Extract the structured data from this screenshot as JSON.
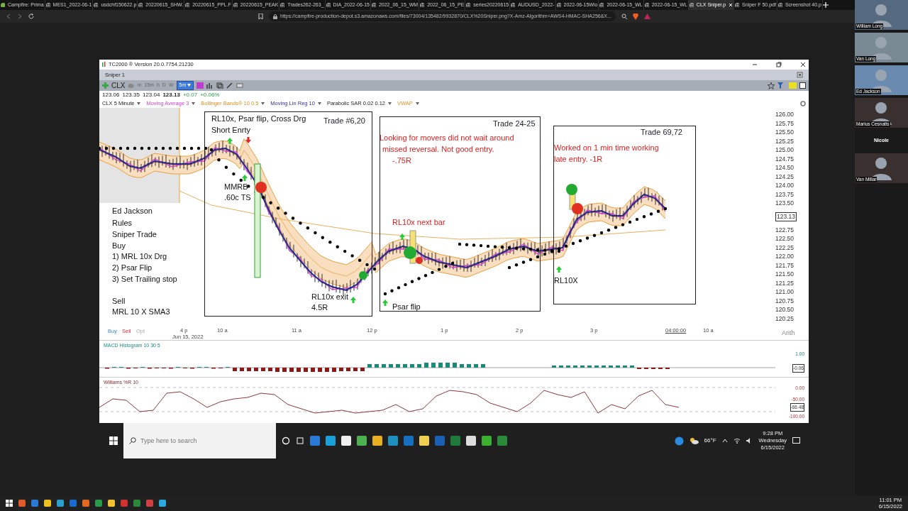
{
  "browser": {
    "tabs": [
      {
        "label": "Campfire: Prima",
        "selected": false
      },
      {
        "label": "MES1_2022-06-1",
        "selected": false
      },
      {
        "label": "usdchf150622.p",
        "selected": false
      },
      {
        "label": "20220615_SHW.",
        "selected": false
      },
      {
        "label": "20220615_PPL.F",
        "selected": false
      },
      {
        "label": "20220615_PEAK",
        "selected": false
      },
      {
        "label": "Trades262-263_",
        "selected": false
      },
      {
        "label": "DIA_2022-06-15",
        "selected": false
      },
      {
        "label": "2022_06_15_WM",
        "selected": false
      },
      {
        "label": "2022_06_15_PE",
        "selected": false
      },
      {
        "label": "series20220615",
        "selected": false
      },
      {
        "label": "AUDUSD_2022-",
        "selected": false
      },
      {
        "label": "2022-06-15Wio",
        "selected": false
      },
      {
        "label": "2022-06-15_WL",
        "selected": false
      },
      {
        "label": "2022-06-15_WL",
        "selected": false
      },
      {
        "label": "CLX Sniper.p",
        "selected": true
      },
      {
        "label": "Sniper F 50.pdf",
        "selected": false
      },
      {
        "label": "Screenshot 40.p",
        "selected": false
      }
    ],
    "url": "https://campfire-production-depot.s3.amazonaws.com/files/73004/135482/9932870/CLX%20Sniper.png?X-Amz-Algorithm=AWS4-HMAC-SHA256&X..."
  },
  "app": {
    "title": "TC2000 ® Version 20.0.7754.21230",
    "layout": "Sniper 1",
    "symbol": "CLX",
    "timeframes": [
      {
        "label": "m",
        "selected": false
      },
      {
        "label": "15m",
        "selected": false
      },
      {
        "label": "h",
        "selected": false
      },
      {
        "label": "D",
        "selected": false
      },
      {
        "label": "W",
        "selected": false
      },
      {
        "label": "5m",
        "selected": true
      }
    ],
    "quotes": [
      "123.06",
      "123.35",
      "123.04",
      "123.13",
      "+0.07",
      "+0.06%"
    ],
    "indicators": [
      {
        "label": "CLX 5 Minute",
        "kind": "price"
      },
      {
        "label": "Moving Average 3",
        "kind": "average"
      },
      {
        "label": "Bollinger Bands® 10 0.5",
        "kind": "band"
      },
      {
        "label": "Moving Lin Reg 10",
        "kind": "regression"
      },
      {
        "label": "Parabolic SAR 0.02 0.12",
        "kind": "sar"
      },
      {
        "label": "VWAP",
        "kind": "vwap"
      }
    ],
    "boxes": [
      {
        "title": "Trade #6,20"
      },
      {
        "title": "Trade 24-25"
      },
      {
        "title": "Trade 69,72"
      }
    ],
    "notes": [
      {
        "text": "RL10x, Psar flip, Cross Drg",
        "kind": "label"
      },
      {
        "text": "Short Enrty",
        "kind": "label"
      },
      {
        "text": "MMRB",
        "kind": "label"
      },
      {
        "text": ".60c TS",
        "kind": "label"
      },
      {
        "text": "RL10x exit",
        "kind": "label"
      },
      {
        "text": "4.5R",
        "kind": "label"
      },
      {
        "text": "Ed Jackson",
        "kind": "label"
      },
      {
        "text": "Rules",
        "kind": "label"
      },
      {
        "text": "Sniper Trade",
        "kind": "label"
      },
      {
        "text": "Buy",
        "kind": "label"
      },
      {
        "text": "1) MRL 10x Drg",
        "kind": "label"
      },
      {
        "text": "2) Psar Flip",
        "kind": "label"
      },
      {
        "text": "3) Set Trailing stop",
        "kind": "label"
      },
      {
        "text": "Sell",
        "kind": "label"
      },
      {
        "text": "MRL 10 X SMA3",
        "kind": "label"
      },
      {
        "text": "Looking for movers did not wait around",
        "kind": "remark"
      },
      {
        "text": "missed reversal. Not good entry.",
        "kind": "remark"
      },
      {
        "text": "-.75R",
        "kind": "remark"
      },
      {
        "text": "RL10x next bar",
        "kind": "remark"
      },
      {
        "text": "Psar flip",
        "kind": "label"
      },
      {
        "text": "Worked on 1 min time working",
        "kind": "remark"
      },
      {
        "text": "late entry. -1R",
        "kind": "remark"
      },
      {
        "text": "RL10X",
        "kind": "label"
      }
    ],
    "price_axis": [
      {
        "text": "126.00",
        "kind": "tick"
      },
      {
        "text": "125.75",
        "kind": "tick"
      },
      {
        "text": "125.50",
        "kind": "tick"
      },
      {
        "text": "125.25",
        "kind": "tick"
      },
      {
        "text": "125.00",
        "kind": "tick"
      },
      {
        "text": "124.75",
        "kind": "tick"
      },
      {
        "text": "124.50",
        "kind": "tick"
      },
      {
        "text": "124.25",
        "kind": "tick"
      },
      {
        "text": "124.00",
        "kind": "tick"
      },
      {
        "text": "123.75",
        "kind": "tick"
      },
      {
        "text": "123.50",
        "kind": "tick"
      },
      {
        "text": "123.13",
        "kind": "marker"
      },
      {
        "text": "122.75",
        "kind": "tick"
      },
      {
        "text": "122.50",
        "kind": "tick"
      },
      {
        "text": "122.25",
        "kind": "tick"
      },
      {
        "text": "122.00",
        "kind": "tick"
      },
      {
        "text": "121.75",
        "kind": "tick"
      },
      {
        "text": "121.50",
        "kind": "tick"
      },
      {
        "text": "121.25",
        "kind": "tick"
      },
      {
        "text": "121.00",
        "kind": "tick"
      },
      {
        "text": "120.75",
        "kind": "tick"
      },
      {
        "text": "120.50",
        "kind": "tick"
      },
      {
        "text": "120.25",
        "kind": "tick"
      }
    ],
    "orders": [
      "Buy",
      "Sell",
      "Opt"
    ],
    "time_axis": [
      "4 p",
      "10 a",
      "11 a",
      "12 p",
      "1 p",
      "2 p",
      "3 p",
      "04:00:00",
      "10 a"
    ],
    "date": "Jun 15, 2022",
    "scale": "Arith",
    "macd": {
      "title": "MACD Histogram 10 30 5",
      "labels": [
        {
          "text": "1.00",
          "kind": "tick"
        },
        {
          "text": "-0.06",
          "kind": "marker"
        }
      ]
    },
    "williams": {
      "title": "Williams %R 10",
      "labels": [
        {
          "text": "0.00",
          "kind": "tick"
        },
        {
          "text": "-50.00",
          "kind": "tick"
        },
        {
          "text": "-66.48",
          "kind": "marker"
        },
        {
          "text": "-100.00",
          "kind": "tick"
        }
      ]
    },
    "taskbar": {
      "search_placeholder": "Type here to search",
      "weather": "66°F",
      "time": "9:28 PM",
      "day": "Wednesday",
      "date": "6/15/2022"
    }
  },
  "participants": [
    {
      "name": "William Long"
    },
    {
      "name": "Van Long"
    },
    {
      "name": "Ed Jackson"
    },
    {
      "name": "Marius Cesnatis"
    },
    {
      "name": "Nicole",
      "kind": "no-video"
    },
    {
      "name": "Van Millar"
    }
  ],
  "taskbar": {
    "time": "11:01 PM",
    "date": "6/15/2022"
  }
}
